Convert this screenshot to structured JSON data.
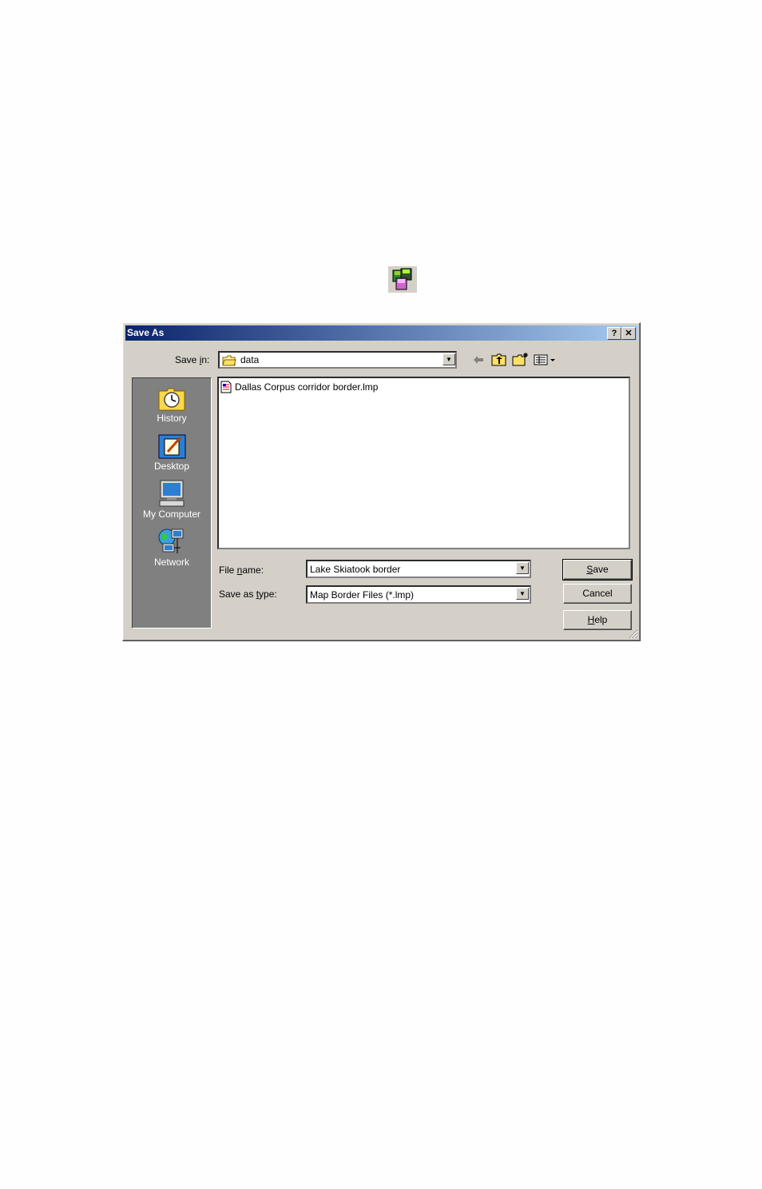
{
  "dialog": {
    "title": "Save As",
    "help_btn": "?",
    "close_btn": "✕"
  },
  "toolbar": {
    "save_in_prefix": "Save ",
    "save_in_accel": "i",
    "save_in_suffix": "n:",
    "save_in_value": "data"
  },
  "places": [
    {
      "label": "History",
      "icon": "history-icon"
    },
    {
      "label": "Desktop",
      "icon": "desktop-icon"
    },
    {
      "label": "My Computer",
      "icon": "my-computer-icon"
    },
    {
      "label": "Network",
      "icon": "network-icon"
    }
  ],
  "files": [
    {
      "name": "Dallas Corpus corridor border.lmp",
      "icon": "document-icon"
    }
  ],
  "form": {
    "file_name_prefix": "File ",
    "file_name_accel": "n",
    "file_name_suffix": "ame:",
    "file_name_value": "Lake Skiatook border",
    "save_type_prefix": "Save as ",
    "save_type_accel": "t",
    "save_type_suffix": "ype:",
    "save_type_value": "Map Border Files (*.lmp)"
  },
  "buttons": {
    "save_accel": "S",
    "save_rest": "ave",
    "cancel": "Cancel",
    "help_accel": "H",
    "help_rest": "elp"
  }
}
